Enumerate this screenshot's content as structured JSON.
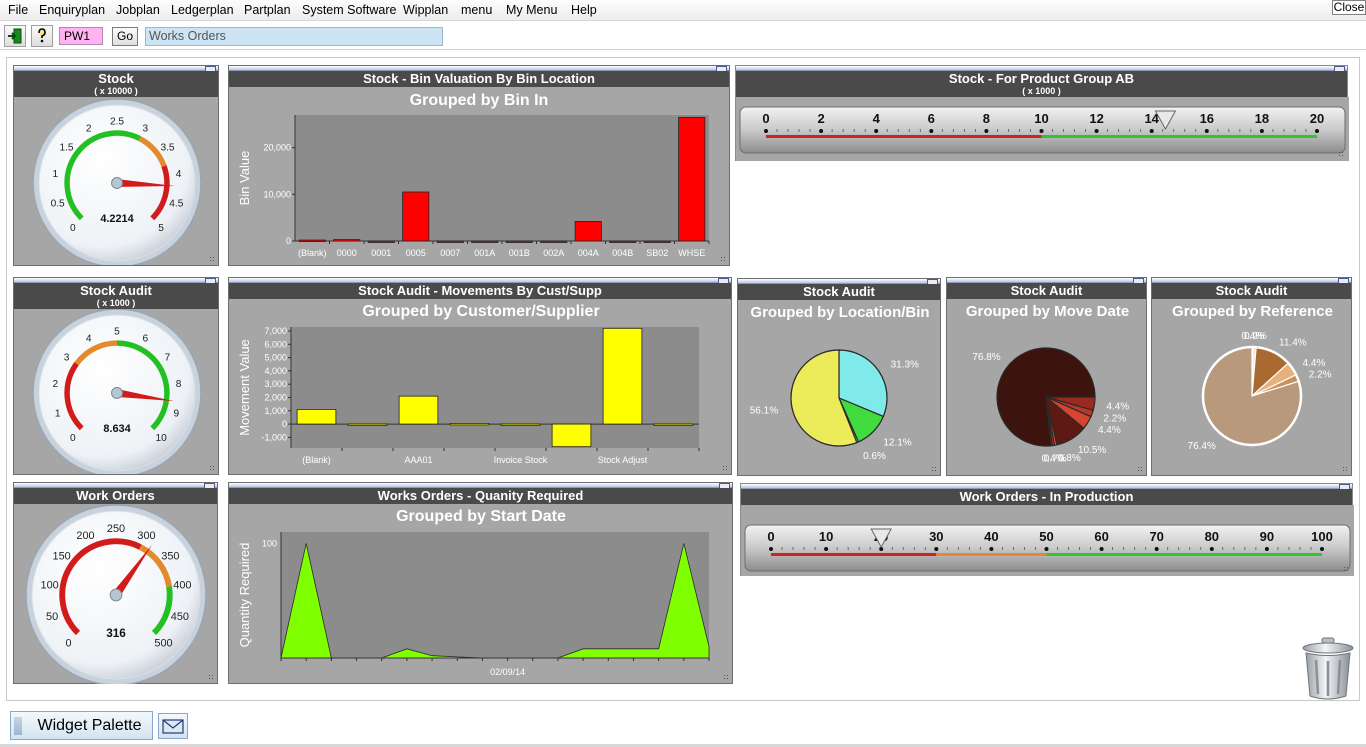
{
  "menu": {
    "items": [
      "File",
      "Enquiryplan",
      "Jobplan",
      "Ledgerplan",
      "Partplan",
      "System Software",
      "Wipplan",
      "menu",
      "My Menu",
      "Help"
    ],
    "close_label": "Close"
  },
  "toolbar": {
    "exit_icon": "exit-door-icon",
    "help_icon": "help-question-icon",
    "code_value": "PW1",
    "go_label": "Go",
    "search_value": "Works Orders"
  },
  "widgets": {
    "stock_gauge": {
      "title": "Stock",
      "subtitle": "( x 10000 )",
      "value": 4.2214,
      "value_label": "4.2214",
      "min": 0,
      "max": 5,
      "ticks": [
        "0",
        "0.5",
        "1",
        "1.5",
        "2",
        "2.5",
        "3",
        "3.5",
        "4",
        "4.5",
        "5"
      ],
      "bands": [
        {
          "from": 0,
          "to": 3,
          "color": "#22c022"
        },
        {
          "from": 3,
          "to": 3.8,
          "color": "#e38a2c"
        },
        {
          "from": 3.8,
          "to": 5,
          "color": "#d21b1b"
        }
      ]
    },
    "bin_valuation": {
      "title": "Stock - Bin Valuation By Bin Location",
      "chart_title": "Grouped by Bin In",
      "y_axis_label": "Bin Value"
    },
    "product_group": {
      "title": "Stock - For Product Group AB",
      "subtitle": "( x 1000 )",
      "ticks": [
        "0",
        "2",
        "4",
        "6",
        "8",
        "10",
        "12",
        "14",
        "16",
        "18",
        "20"
      ],
      "min": 0,
      "max": 20,
      "pointer": 14.5,
      "bands": [
        {
          "from": 0,
          "to": 10,
          "color": "#d32020"
        },
        {
          "from": 10,
          "to": 20,
          "color": "#2ec82e"
        }
      ]
    },
    "stock_audit_gauge": {
      "title": "Stock Audit",
      "subtitle": "( x 1000 )",
      "value": 8.634,
      "value_label": "8.634",
      "min": 0,
      "max": 10,
      "ticks": [
        "0",
        "1",
        "2",
        "3",
        "4",
        "5",
        "6",
        "7",
        "8",
        "9",
        "10"
      ],
      "bands": [
        {
          "from": 0,
          "to": 3,
          "color": "#d21b1b"
        },
        {
          "from": 3,
          "to": 5,
          "color": "#e38a2c"
        },
        {
          "from": 5,
          "to": 10,
          "color": "#22c022"
        }
      ]
    },
    "movements": {
      "title": "Stock Audit - Movements By Cust/Supp",
      "chart_title": "Grouped by Customer/Supplier",
      "y_axis_label": "Movement Value"
    },
    "location_pie": {
      "title": "Stock Audit",
      "chart_title": "Grouped by Location/Bin"
    },
    "move_date_pie": {
      "title": "Stock Audit",
      "chart_title": "Grouped by Move Date"
    },
    "reference_pie": {
      "title": "Stock Audit",
      "chart_title": "Grouped by Reference"
    },
    "work_orders_gauge": {
      "title": "Work Orders",
      "value": 316,
      "value_label": "316",
      "min": 0,
      "max": 500,
      "ticks": [
        "0",
        "50",
        "100",
        "150",
        "200",
        "250",
        "300",
        "350",
        "400",
        "450",
        "500"
      ],
      "bands": [
        {
          "from": 0,
          "to": 300,
          "color": "#d21b1b"
        },
        {
          "from": 300,
          "to": 400,
          "color": "#e38a2c"
        },
        {
          "from": 400,
          "to": 500,
          "color": "#22c022"
        }
      ]
    },
    "quantity_required": {
      "title": "Works Orders - Quanity Required",
      "chart_title": "Grouped by Start Date",
      "y_axis_label": "Quantity Required"
    },
    "in_production": {
      "title": "Work Orders - In Production",
      "ticks": [
        "0",
        "10",
        "20",
        "30",
        "40",
        "50",
        "60",
        "70",
        "80",
        "90",
        "100"
      ],
      "min": 0,
      "max": 100,
      "pointer": 20,
      "bands": [
        {
          "from": 0,
          "to": 30,
          "color": "#d32020"
        },
        {
          "from": 30,
          "to": 50,
          "color": "#e38a2c"
        },
        {
          "from": 50,
          "to": 100,
          "color": "#2ec82e"
        }
      ]
    }
  },
  "bottom": {
    "palette_label": "Widget Palette",
    "mail_icon": "envelope-icon",
    "trash_icon": "trash-can-icon"
  },
  "chart_data": [
    {
      "type": "bar",
      "title": "Grouped by Bin In",
      "xlabel": "",
      "ylabel": "Bin Value",
      "categories": [
        "(Blank)",
        "0000",
        "0001",
        "0005",
        "0007",
        "001A",
        "001B",
        "002A",
        "004A",
        "004B",
        "SB02",
        "WHSE"
      ],
      "values": [
        200,
        300,
        0,
        10500,
        0,
        0,
        0,
        0,
        4200,
        0,
        0,
        26500
      ],
      "ylim": [
        0,
        27000
      ],
      "yticks": [
        "0",
        "10,000",
        "20,000"
      ],
      "bar_color": "#ff0000"
    },
    {
      "type": "bar",
      "title": "Grouped by Customer/Supplier",
      "xlabel": "",
      "ylabel": "Movement Value",
      "categories": [
        "(Blank)",
        "",
        "AAA01",
        "",
        "Invoice Stock",
        "",
        "Stock Adjust",
        ""
      ],
      "values": [
        1100,
        -100,
        2100,
        50,
        -50,
        -1700,
        7200,
        -100
      ],
      "ylim": [
        -1800,
        7300
      ],
      "yticks": [
        "-1,000",
        "0",
        "1,000",
        "2,000",
        "3,000",
        "4,000",
        "5,000",
        "6,000",
        "7,000"
      ],
      "bar_color": "#ffff00"
    },
    {
      "type": "pie",
      "title": "Grouped by Location/Bin",
      "slices": [
        {
          "label": "31.3%",
          "value": 31.3,
          "color": "#80eaea"
        },
        {
          "label": "12.1%",
          "value": 12.1,
          "color": "#3fdb3f"
        },
        {
          "label": "0.6%",
          "value": 0.6,
          "color": "#c0e070"
        },
        {
          "label": "56.1%",
          "value": 56.1,
          "color": "#ecec5a"
        }
      ]
    },
    {
      "type": "pie",
      "title": "Grouped by Move Date",
      "slices": [
        {
          "label": "4.4%",
          "value": 4.4,
          "color": "#9a2a1e"
        },
        {
          "label": "2.2%",
          "value": 2.2,
          "color": "#b8382a"
        },
        {
          "label": "4.4%",
          "value": 4.4,
          "color": "#d64532"
        },
        {
          "label": "10.5%",
          "value": 10.5,
          "color": "#5e1a12"
        },
        {
          "label": "0.8%",
          "value": 0.8,
          "color": "#e85038"
        },
        {
          "label": "0.7%",
          "value": 0.7,
          "color": "#c43c2c"
        },
        {
          "label": "0.4%",
          "value": 0.4,
          "color": "#a83224"
        },
        {
          "label": "76.8%",
          "value": 76.8,
          "color": "#3d130d"
        }
      ]
    },
    {
      "type": "pie",
      "title": "Grouped by Reference",
      "slices": [
        {
          "label": "0.4%",
          "value": 0.4,
          "color": "#e6cfb4"
        },
        {
          "label": "0.9%",
          "value": 0.9,
          "color": "#f0dcc4"
        },
        {
          "label": "11.4%",
          "value": 11.4,
          "color": "#a86a30"
        },
        {
          "label": "4.4%",
          "value": 4.4,
          "color": "#e8b07c"
        },
        {
          "label": "2.2%",
          "value": 2.2,
          "color": "#c8925e"
        },
        {
          "label": "76.4%",
          "value": 76.4,
          "color": "#b9997c"
        }
      ]
    },
    {
      "type": "area",
      "title": "Grouped by Start Date",
      "xlabel": "",
      "ylabel": "Quantity Required",
      "x_tick_labels": [
        "02/09/14"
      ],
      "values": [
        0,
        100,
        0,
        0,
        0,
        8,
        2,
        1,
        0,
        0,
        0,
        0,
        8,
        8,
        8,
        8,
        100,
        10
      ],
      "ylim": [
        0,
        110
      ],
      "yticks": [
        "100"
      ],
      "fill_color": "#80ff00"
    }
  ]
}
